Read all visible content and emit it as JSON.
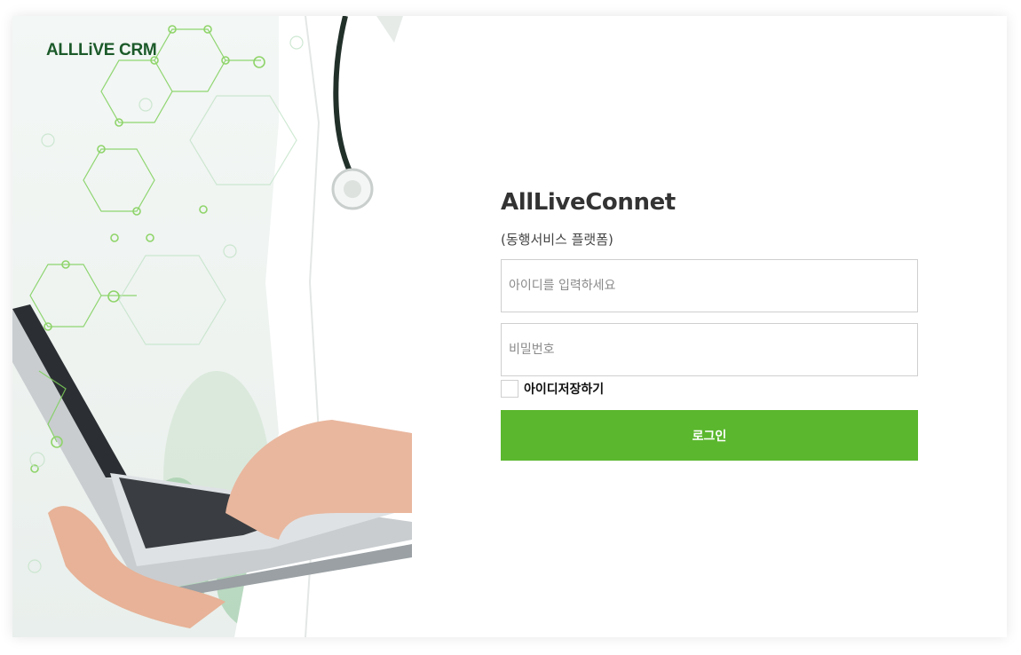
{
  "brand": {
    "logo_text": "ALLLiVE CRM"
  },
  "login": {
    "title": "AllLiveConnet",
    "subtitle": "(동행서비스 플랫폼)",
    "id_placeholder": "아이디를 입력하세요",
    "id_value": "",
    "password_placeholder": "비밀번호",
    "password_value": "",
    "save_id_label": "아이디저장하기",
    "save_id_checked": false,
    "submit_label": "로그인"
  },
  "colors": {
    "accent": "#5bb72e",
    "brand_green": "#1c5a2a",
    "input_border": "#cfcfcf"
  }
}
